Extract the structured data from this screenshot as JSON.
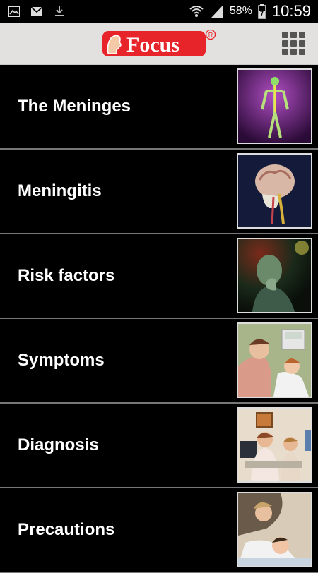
{
  "status_bar": {
    "battery": "58%",
    "time": "10:59"
  },
  "header": {
    "logo_text": "Focus",
    "logo_mark": "®",
    "menu_icon": "grid-menu-icon"
  },
  "topics": [
    {
      "label": "The Meninges",
      "thumb_icon": "nervous-system-illustration"
    },
    {
      "label": "Meningitis",
      "thumb_icon": "brain-head-illustration"
    },
    {
      "label": "Risk factors",
      "thumb_icon": "sick-man-illustration"
    },
    {
      "label": "Symptoms",
      "thumb_icon": "parent-child-fever-illustration"
    },
    {
      "label": "Diagnosis",
      "thumb_icon": "doctor-consultation-illustration"
    },
    {
      "label": "Precautions",
      "thumb_icon": "mother-child-care-illustration"
    }
  ],
  "colors": {
    "header_bg": "#e2e1df",
    "logo_red": "#e8242b",
    "list_bg": "#000000",
    "divider": "#777777"
  }
}
